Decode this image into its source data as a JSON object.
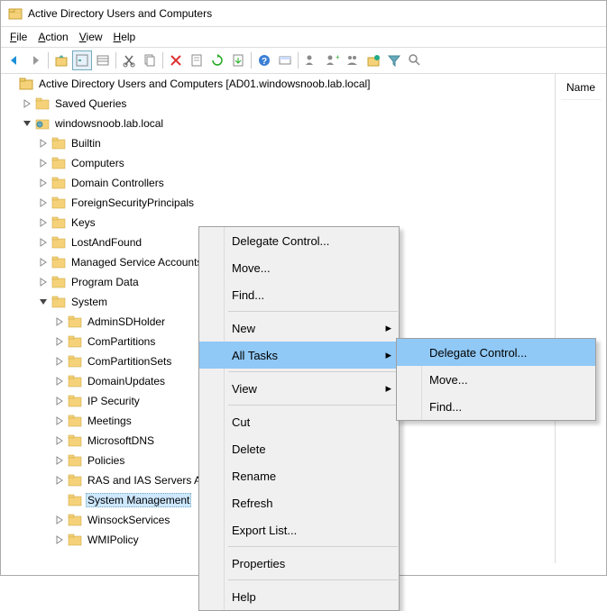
{
  "window": {
    "title": "Active Directory Users and Computers"
  },
  "menubar": {
    "file": "File",
    "action": "Action",
    "view": "View",
    "help": "Help"
  },
  "list": {
    "header_name": "Name"
  },
  "tree": {
    "root": "Active Directory Users and Computers [AD01.windowsnoob.lab.local]",
    "saved_queries": "Saved Queries",
    "domain": "windowsnoob.lab.local",
    "nodes": [
      "Builtin",
      "Computers",
      "Domain Controllers",
      "ForeignSecurityPrincipals",
      "Keys",
      "LostAndFound",
      "Managed Service Accounts",
      "Program Data",
      "System"
    ],
    "system_children": [
      "AdminSDHolder",
      "ComPartitions",
      "ComPartitionSets",
      "DomainUpdates",
      "IP Security",
      "Meetings",
      "MicrosoftDNS",
      "Policies",
      "RAS and IAS Servers Access Check",
      "System Management",
      "WinsockServices",
      "WMIPolicy"
    ]
  },
  "ctx1": {
    "delegate": "Delegate Control...",
    "move": "Move...",
    "find": "Find...",
    "new": "New",
    "all_tasks": "All Tasks",
    "view": "View",
    "cut": "Cut",
    "delete": "Delete",
    "rename": "Rename",
    "refresh": "Refresh",
    "export": "Export List...",
    "properties": "Properties",
    "help": "Help"
  },
  "ctx2": {
    "delegate": "Delegate Control...",
    "move": "Move...",
    "find": "Find..."
  }
}
